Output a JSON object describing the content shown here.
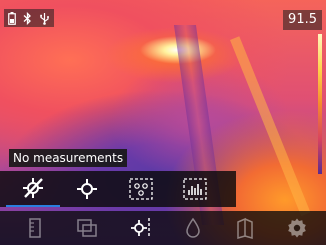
{
  "status": {
    "icons": [
      "battery-icon",
      "bluetooth-icon",
      "usb-icon"
    ],
    "temperature": "91.5"
  },
  "tooltip": {
    "text": "No measurements"
  },
  "measurement_modes": [
    {
      "icon": "no-measurement-icon",
      "active": true
    },
    {
      "icon": "center-spot-icon",
      "active": false
    },
    {
      "icon": "area-hot-cold-icon",
      "active": false
    },
    {
      "icon": "area-histogram-icon",
      "active": false
    }
  ],
  "toolbar": [
    {
      "icon": "color-palette-icon"
    },
    {
      "icon": "picture-in-picture-icon"
    },
    {
      "icon": "measurement-icon"
    },
    {
      "icon": "humidity-icon"
    },
    {
      "icon": "emissivity-icon"
    },
    {
      "icon": "settings-gear-icon"
    }
  ],
  "colors": {
    "accent": "#2a7fe0",
    "overlay": "#1a1a1a"
  }
}
